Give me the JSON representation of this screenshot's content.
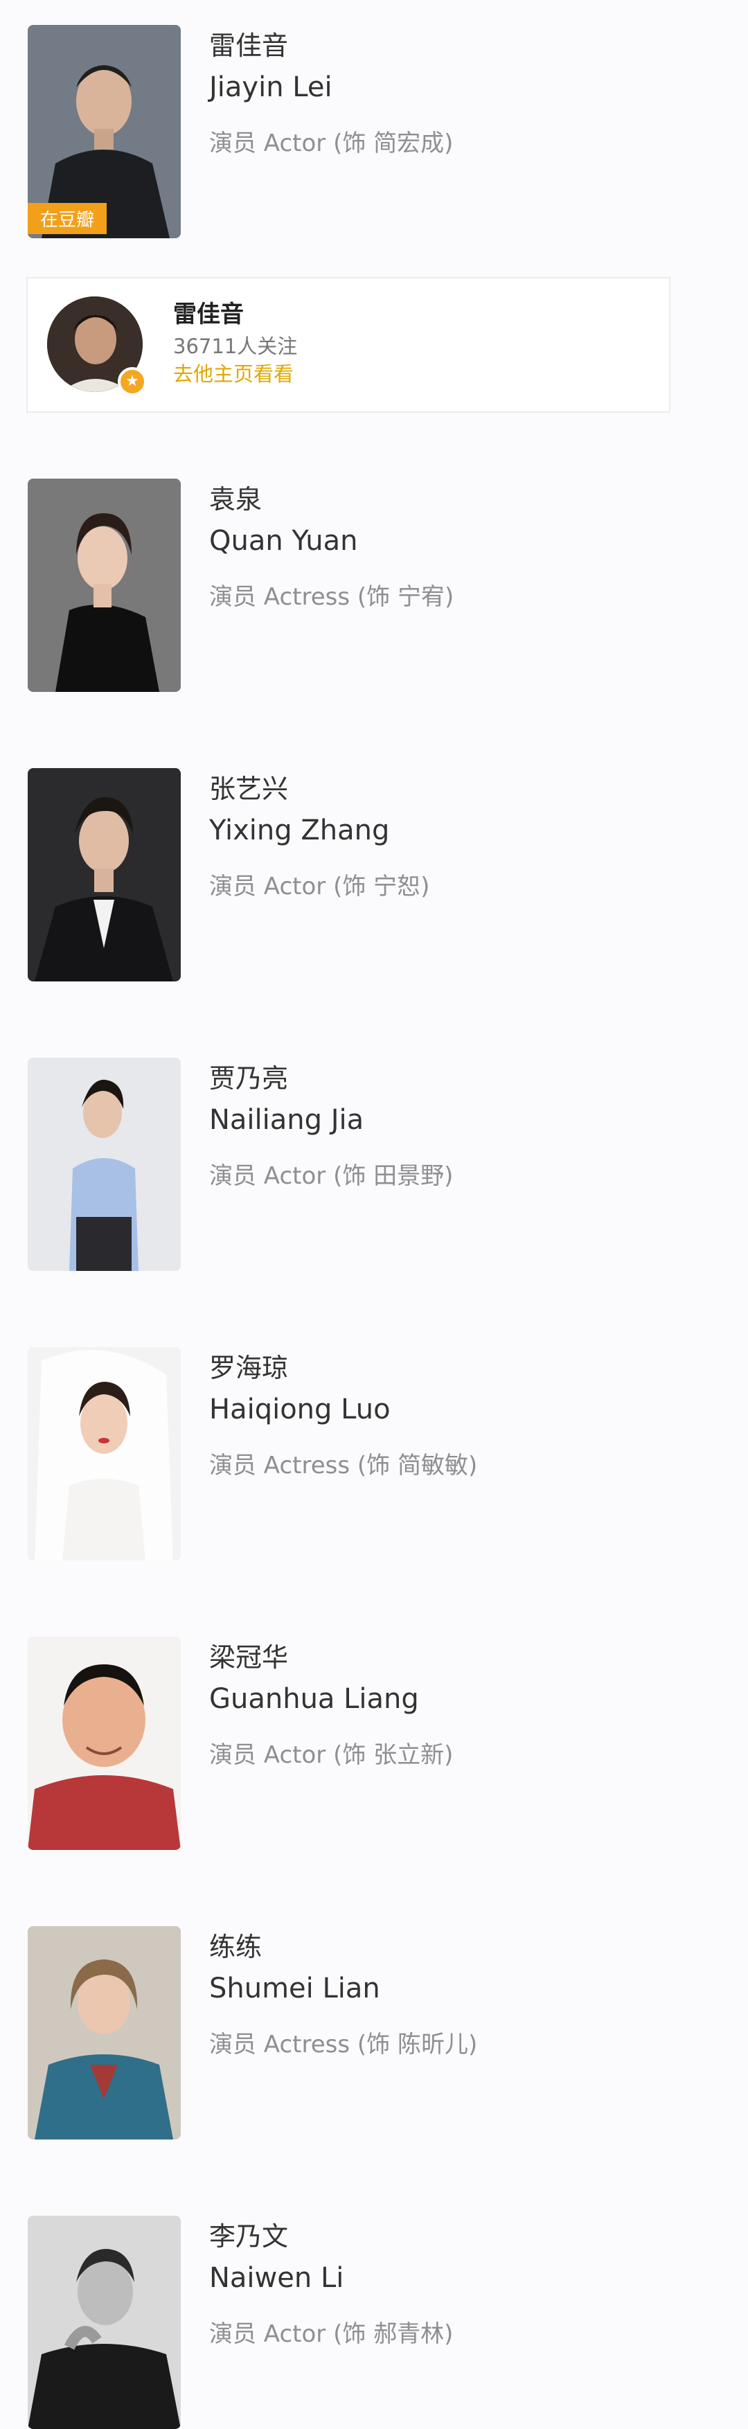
{
  "cast": [
    {
      "name_cn": "雷佳音",
      "name_en": "Jiayin Lei",
      "role": "演员 Actor (饰 简宏成)",
      "badge": "在豆瓣"
    },
    {
      "name_cn": "袁泉",
      "name_en": "Quan Yuan",
      "role": "演员 Actress (饰 宁宥)"
    },
    {
      "name_cn": "张艺兴",
      "name_en": "Yixing Zhang",
      "role": "演员 Actor (饰 宁恕)"
    },
    {
      "name_cn": "贾乃亮",
      "name_en": "Nailiang Jia",
      "role": "演员 Actor (饰 田景野)"
    },
    {
      "name_cn": "罗海琼",
      "name_en": "Haiqiong Luo",
      "role": "演员 Actress (饰 简敏敏)"
    },
    {
      "name_cn": "梁冠华",
      "name_en": "Guanhua Liang",
      "role": "演员 Actor (饰 张立新)"
    },
    {
      "name_cn": "练练",
      "name_en": "Shumei Lian",
      "role": "演员 Actress (饰 陈昕儿)"
    },
    {
      "name_cn": "李乃文",
      "name_en": "Naiwen Li",
      "role": "演员 Actor (饰 郝青林)"
    }
  ],
  "follow_card": {
    "name": "雷佳音",
    "followers": "36711人关注",
    "link": "去他主页看看"
  },
  "colors": {
    "badge": "#f2a01a",
    "link": "#e0a800",
    "role_text": "#8e8e93"
  }
}
